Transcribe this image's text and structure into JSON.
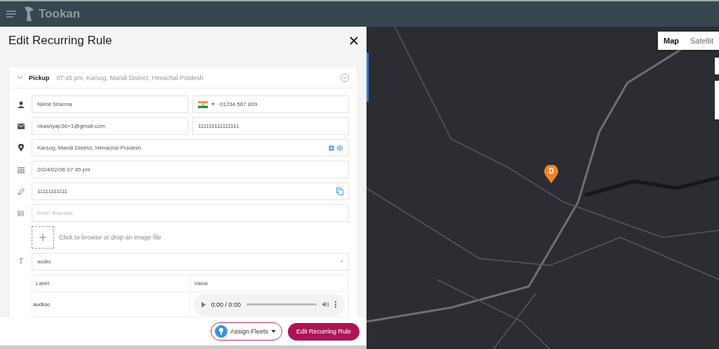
{
  "app_bar": {
    "brand": "Tookan"
  },
  "dialog": {
    "title": "Edit Recurring Rule"
  },
  "pickup": {
    "label": "Pickup",
    "summary": "07:45 pm, Karsog, Mandi District, Himachal Pradesh"
  },
  "rows": [
    {
      "kind": "contact",
      "fields": [
        {
          "value": "Nikhil Sharma"
        },
        {
          "value": "01234 567 809",
          "kind": "phone"
        }
      ]
    },
    {
      "kind": "email",
      "fields": [
        {
          "value": "nkashyap36+1@gmail.com"
        },
        {
          "value": "111111111111111"
        }
      ]
    },
    {
      "kind": "address",
      "fields": [
        {
          "value": "Karsog, Mandi District, Himachal Pradesh"
        }
      ]
    },
    {
      "kind": "datetime",
      "fields": [
        {
          "value": "2024/02/06 07:45 pm"
        }
      ]
    },
    {
      "kind": "notes",
      "fields": [
        {
          "value": "11111111111"
        }
      ]
    },
    {
      "kind": "barcode",
      "fields": [
        {
          "placeholder": "Enter Barcode"
        }
      ]
    }
  ],
  "image_upload": {
    "hint": "Click to browse or drop an image file"
  },
  "template": {
    "type_mark": "T",
    "value": "audio"
  },
  "custom_table": {
    "columns": [
      "Label",
      "Value"
    ],
    "rows": [
      {
        "label": "audioo",
        "time": "0:00 / 0:00"
      }
    ]
  },
  "footer": {
    "assign": "Assign Fleets",
    "submit": "Edit Recurring Rule"
  },
  "map": {
    "tabs": [
      {
        "label": "Map",
        "selected": true
      },
      {
        "label": "Satellit",
        "selected": false
      }
    ],
    "marker": "D"
  }
}
